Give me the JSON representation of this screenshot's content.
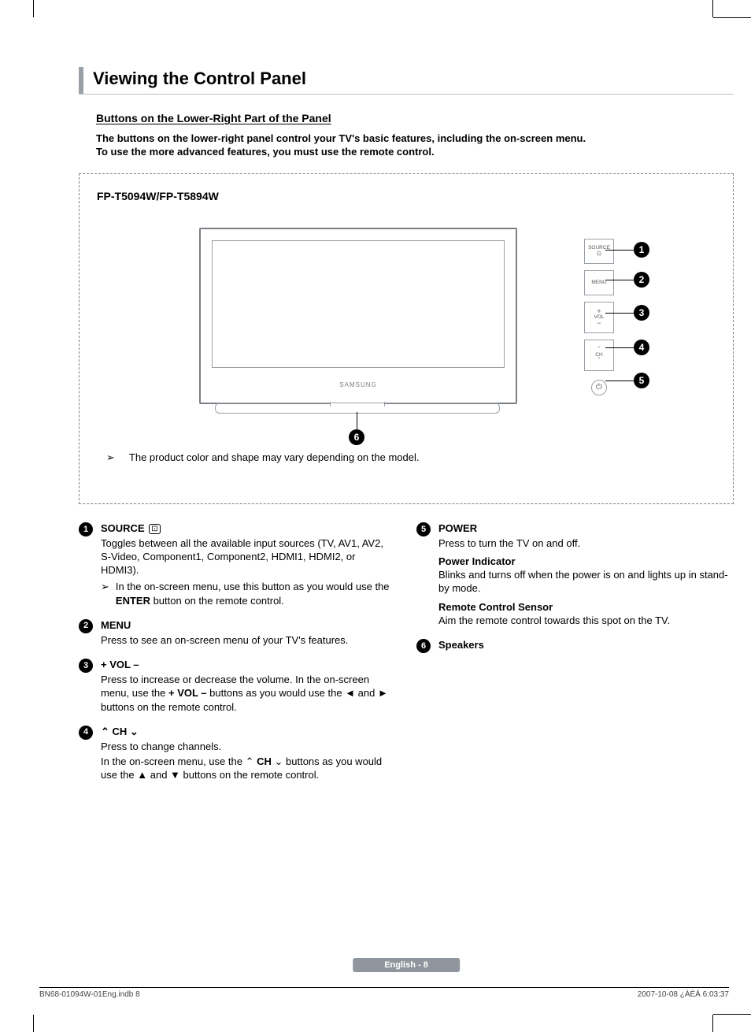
{
  "header": {
    "title": "Viewing the Control Panel",
    "subhead": "Buttons on the Lower-Right Part of the Panel",
    "intro_l1": "The buttons on the lower-right panel control your TV's basic features, including the on-screen menu.",
    "intro_l2": "To use the more advanced features, you must use the remote control."
  },
  "diagram": {
    "model": "FP-T5094W/FP-T5894W",
    "brand": "SAMSUNG",
    "note": "The product color and shape may vary depending on the model.",
    "panel": {
      "source": "SOURCE",
      "menu": "MENU",
      "vol": "VOL",
      "ch": "CH"
    },
    "callouts": {
      "c1": "1",
      "c2": "2",
      "c3": "3",
      "c4": "4",
      "c5": "5",
      "c6": "6"
    }
  },
  "items": {
    "i1": {
      "num": "1",
      "title": "SOURCE",
      "body": "Toggles between all the available input sources (TV, AV1, AV2, S-Video, Component1, Component2, HDMI1, HDMI2, or HDMI3).",
      "note_a": "In the on-screen menu, use this button as you would use the ",
      "note_enter": "ENTER",
      "note_b": " button on the remote control."
    },
    "i2": {
      "num": "2",
      "title": "MENU",
      "body": "Press to see an on-screen menu of your TV's features."
    },
    "i3": {
      "num": "3",
      "title": "+ VOL –",
      "body_a": "Press to increase or decrease the volume. In the on-screen menu, use the ",
      "body_bold": "+ VOL –",
      "body_b": " buttons as you would use the ◄ and ► buttons on the remote control."
    },
    "i4": {
      "num": "4",
      "title_pre_icon": "⌃",
      "title_mid": " CH ",
      "title_post_icon": "⌄",
      "body_a": "Press to change channels.",
      "body_b": "In the on-screen menu, use the ",
      "body_bold": "CH",
      "body_c": " buttons as you would use the ▲ and ▼ buttons on the remote control."
    },
    "i5": {
      "num": "5",
      "title": "POWER",
      "body": "Press to turn the TV on and off.",
      "sub1_t": "Power Indicator",
      "sub1_b": "Blinks and turns off when the power is on and lights up in stand-by mode.",
      "sub2_t": "Remote Control Sensor",
      "sub2_b": "Aim the remote control towards this spot on the TV."
    },
    "i6": {
      "num": "6",
      "title": "Speakers"
    }
  },
  "footer": {
    "pill": "English - 8",
    "file": "BN68-01094W-01Eng.indb   8",
    "stamp": "2007-10-08   ¿ÀÈÄ 6:03:37"
  }
}
